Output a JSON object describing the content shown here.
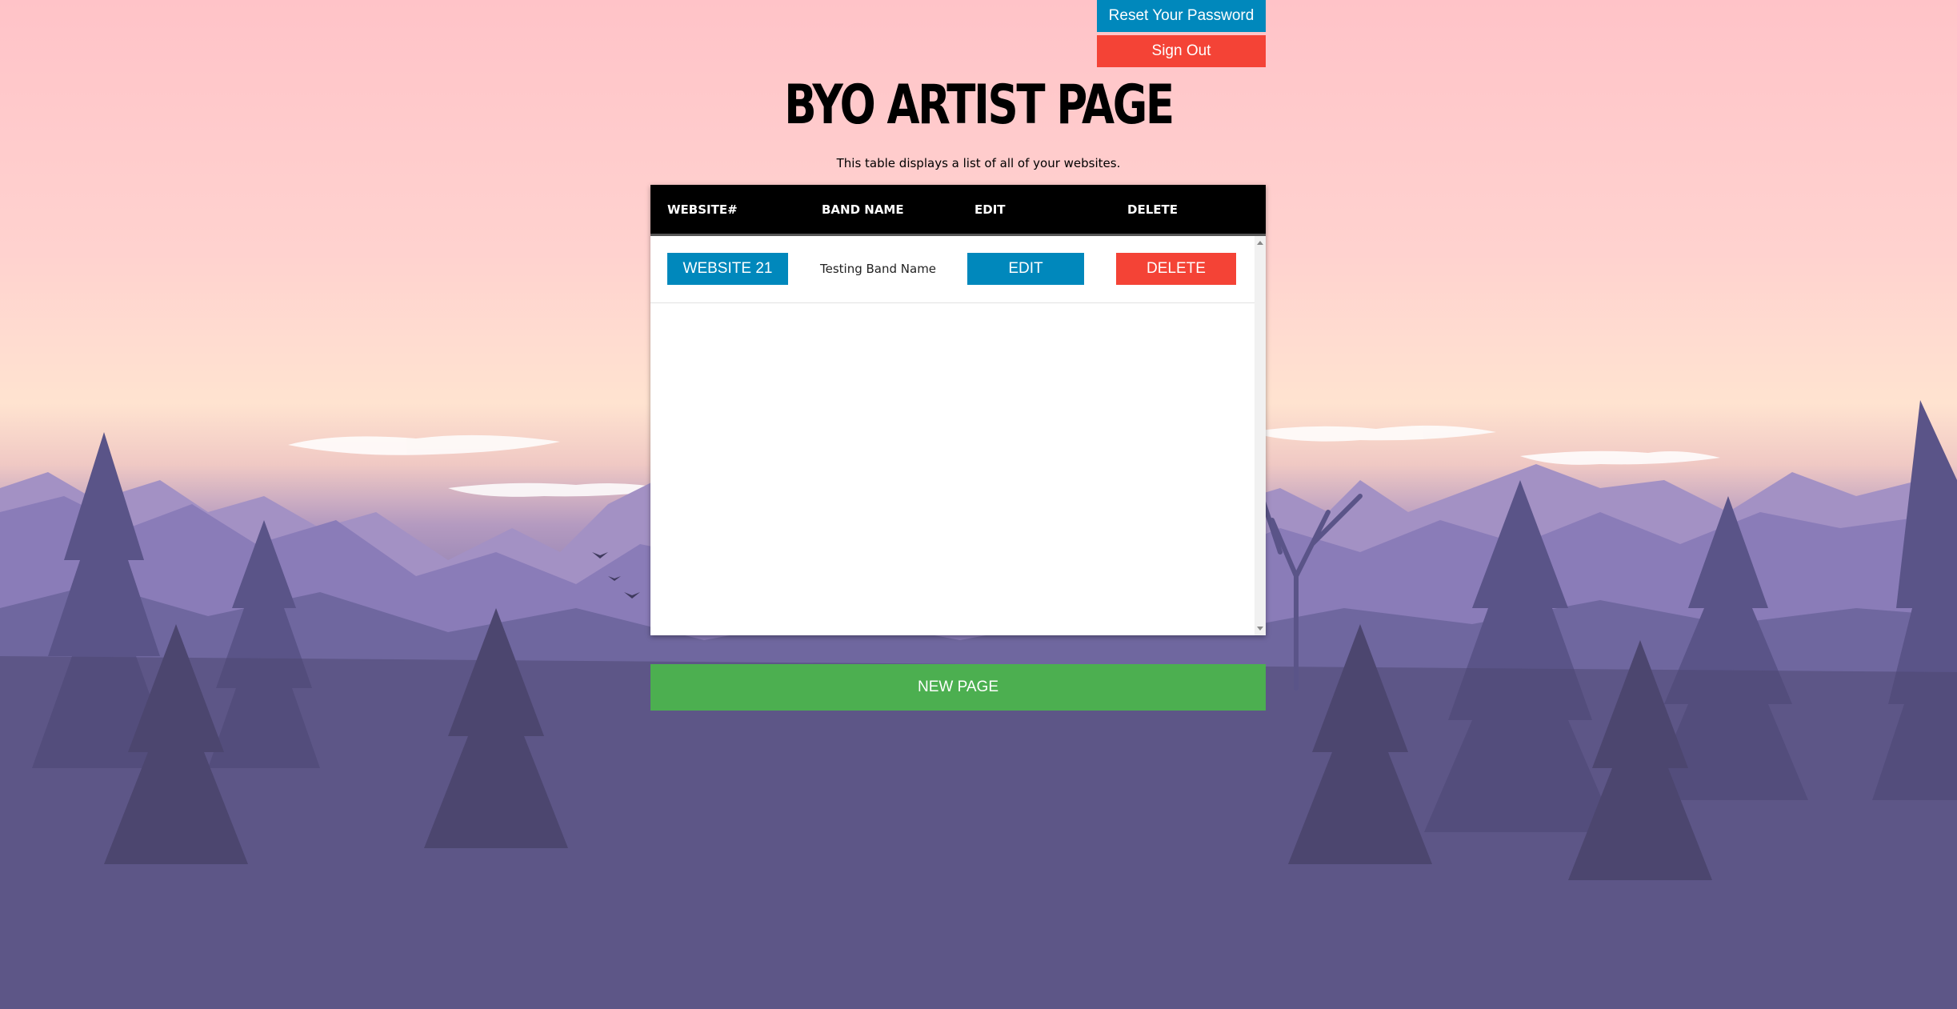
{
  "auth": {
    "reset_label": "Reset Your Password",
    "signout_label": "Sign Out"
  },
  "header": {
    "title": "BYO ARTIST PAGE",
    "subtitle": "This table displays a list of all of your websites."
  },
  "table": {
    "columns": [
      "WEBSITE#",
      "BAND NAME",
      "EDIT",
      "DELETE"
    ],
    "rows": [
      {
        "website_label": "WEBSITE 21",
        "band_name": "Testing Band Name",
        "edit_label": "EDIT",
        "delete_label": "DELETE"
      }
    ]
  },
  "actions": {
    "new_page_label": "NEW PAGE"
  },
  "colors": {
    "primary_blue": "#0088bc",
    "danger_red": "#f44336",
    "success_green": "#4caf50"
  }
}
